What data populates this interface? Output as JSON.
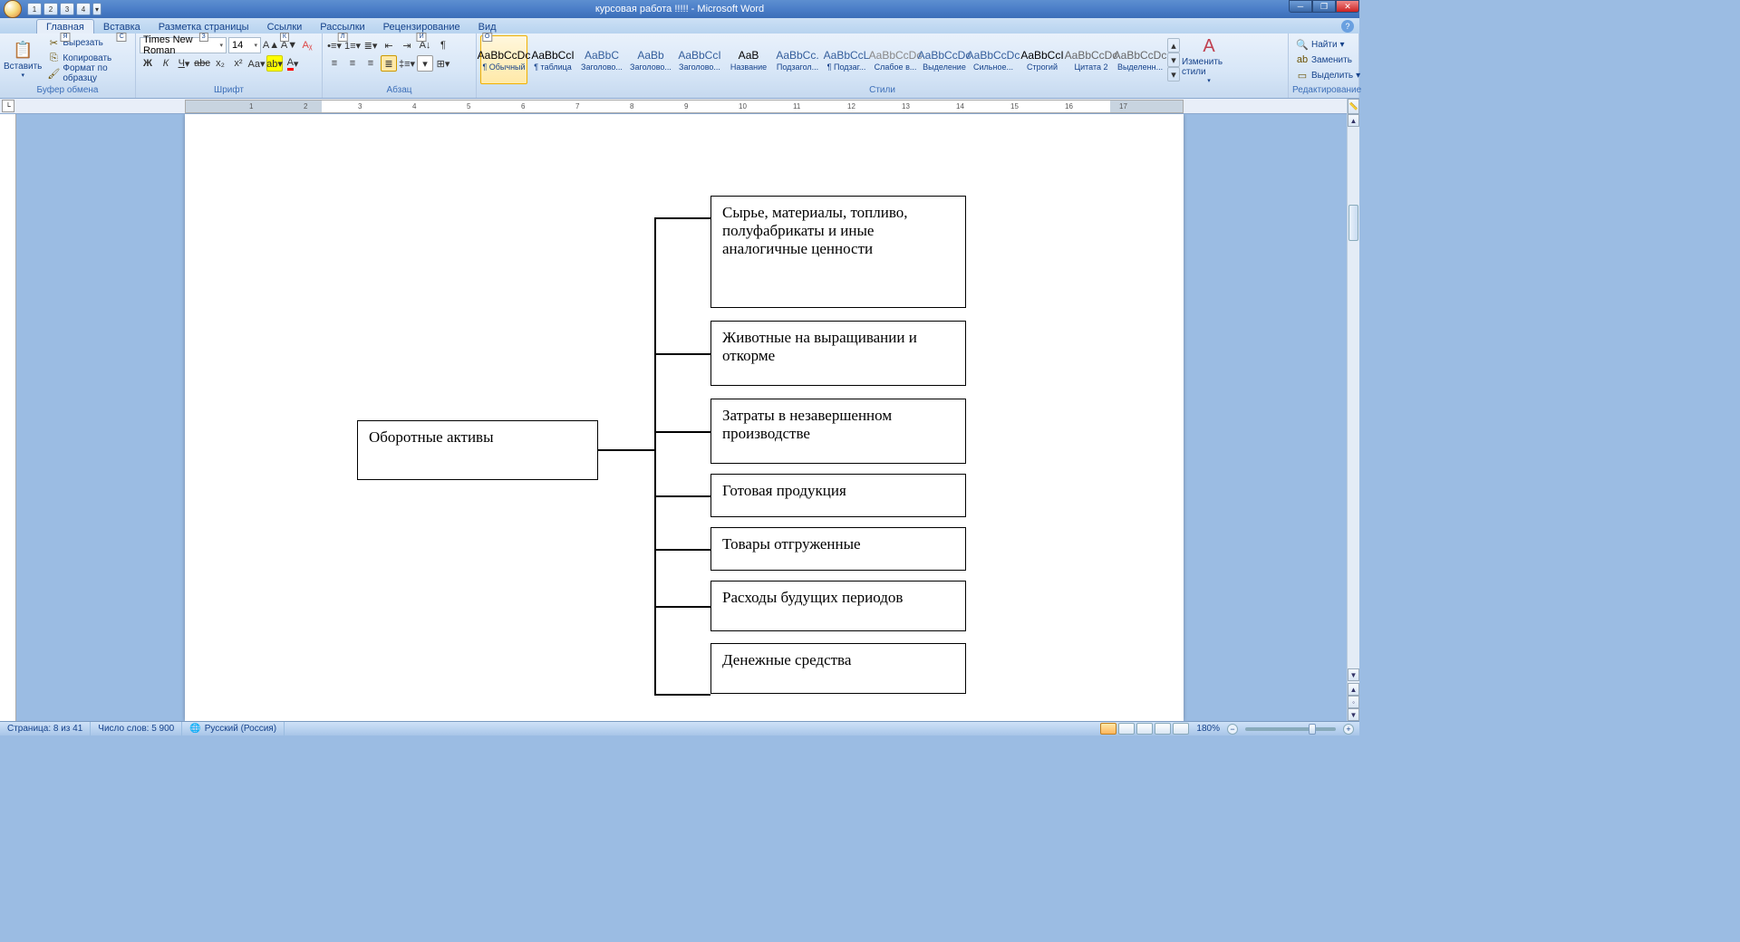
{
  "title": "курсовая работа !!!!! - Microsoft Word",
  "qat": [
    "1",
    "2",
    "3",
    "4"
  ],
  "tabs": [
    {
      "label": "Главная",
      "key": "Я",
      "active": true
    },
    {
      "label": "Вставка",
      "key": "С"
    },
    {
      "label": "Разметка страницы",
      "key": "З"
    },
    {
      "label": "Ссылки",
      "key": "К"
    },
    {
      "label": "Рассылки",
      "key": "Л"
    },
    {
      "label": "Рецензирование",
      "key": "И"
    },
    {
      "label": "Вид",
      "key": "О"
    }
  ],
  "clipboard": {
    "paste": "Вставить",
    "cut": "Вырезать",
    "copy": "Копировать",
    "format": "Формат по образцу",
    "title": "Буфер обмена"
  },
  "font": {
    "name": "Times New Roman",
    "size": "14",
    "title": "Шрифт"
  },
  "paragraph": {
    "title": "Абзац"
  },
  "styles": {
    "title": "Стили",
    "change": "Изменить стили",
    "items": [
      {
        "preview": "AaBbCcDc",
        "label": "¶ Обычный",
        "active": true
      },
      {
        "preview": "AaBbCcI",
        "label": "¶ таблица"
      },
      {
        "preview": "AaBbC",
        "label": "Заголово..."
      },
      {
        "preview": "AaBb",
        "label": "Заголово..."
      },
      {
        "preview": "AaBbCcI",
        "label": "Заголово..."
      },
      {
        "preview": "АаВ",
        "label": "Название"
      },
      {
        "preview": "AaBbCc.",
        "label": "Подзагол..."
      },
      {
        "preview": "AaBbCcL",
        "label": "¶ Подзаг..."
      },
      {
        "preview": "AaBbCcDc",
        "label": "Слабое в..."
      },
      {
        "preview": "AaBbCcDc",
        "label": "Выделение"
      },
      {
        "preview": "AaBbCcDc",
        "label": "Сильное..."
      },
      {
        "preview": "AaBbCcI",
        "label": "Строгий"
      },
      {
        "preview": "AaBbCcDc",
        "label": "Цитата 2"
      },
      {
        "preview": "AaBbCcDc",
        "label": "Выделенн..."
      }
    ]
  },
  "editing": {
    "title": "Редактирование",
    "find": "Найти",
    "replace": "Заменить",
    "select": "Выделить"
  },
  "diagram": {
    "root": "Оборотные активы",
    "items": [
      "Сырье, материалы, топливо, полуфабрикаты и иные аналогичные ценности",
      "Животные на выращивании и откорме",
      "Затраты в незавершенном производстве",
      "Готовая продукция",
      "Товары отгруженные",
      "Расходы будущих периодов",
      "Денежные средства"
    ]
  },
  "status": {
    "page": "Страница: 8 из 41",
    "words": "Число слов: 5 900",
    "lang": "Русский (Россия)",
    "zoom": "180%"
  },
  "ruler_max": 17
}
